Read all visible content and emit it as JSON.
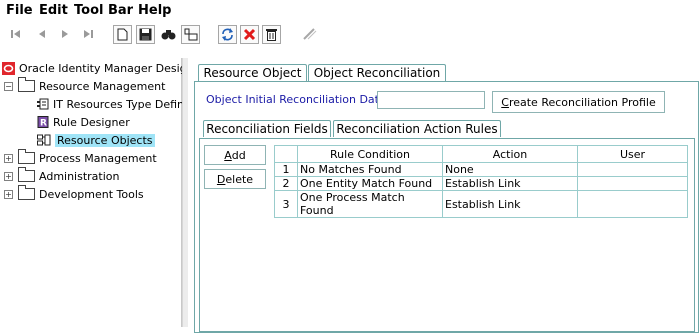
{
  "menu": {
    "file": "File",
    "edit": "Edit",
    "toolbar": "Tool Bar",
    "help": "Help"
  },
  "toolbar": {
    "icons": [
      "first-record-icon",
      "previous-record-icon",
      "next-record-icon",
      "last-record-icon",
      "new-icon",
      "save-icon",
      "find-icon",
      "assign-icon",
      "refresh-icon",
      "delete-icon",
      "trash-icon",
      "disabled-tool-icon"
    ],
    "colors": {
      "refresh": "#1f5fb8",
      "delete": "#e11b1b"
    }
  },
  "tree": {
    "root": "Oracle Identity Manager Design",
    "resource_management": "Resource Management",
    "it_resources": "IT Resources Type Defini",
    "rule_designer": "Rule Designer",
    "resource_objects": "Resource Objects",
    "process_management": "Process Management",
    "administration": "Administration",
    "development_tools": "Development Tools"
  },
  "tabs": {
    "resource_object": "Resource Object",
    "object_reconciliation": "Object Reconciliation"
  },
  "form": {
    "initial_recon_date_label": "Object Initial Reconciliation Date",
    "initial_recon_date_value": "",
    "create_profile_button_first": "C",
    "create_profile_button_rest": "reate Reconciliation Profile"
  },
  "subtabs": {
    "reconciliation_fields": "Reconciliation Fields",
    "reconciliation_action_rules": "Reconciliation Action Rules"
  },
  "buttons": {
    "add_first": "A",
    "add_rest": "dd",
    "delete_first": "D",
    "delete_rest": "elete"
  },
  "table": {
    "headers": [
      "",
      "Rule Condition",
      "Action",
      "User"
    ],
    "rows": [
      {
        "num": "1",
        "condition": "No Matches Found",
        "action": "None",
        "user": ""
      },
      {
        "num": "2",
        "condition": "One Entity Match Found",
        "action": "Establish Link",
        "user": ""
      },
      {
        "num": "3",
        "condition": "One Process Match Found",
        "action": "Establish Link",
        "user": ""
      }
    ]
  }
}
